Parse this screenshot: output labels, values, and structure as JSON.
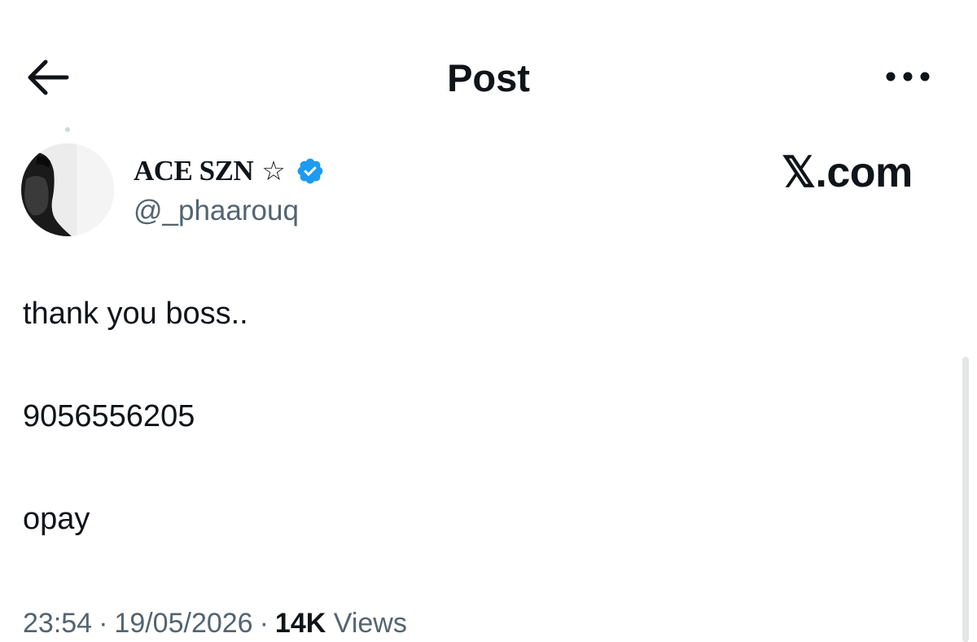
{
  "header": {
    "title": "Post",
    "back_icon": "arrow-left-icon",
    "more_icon": "more-horizontal-icon"
  },
  "author": {
    "display_name": "ACE SZN",
    "name_symbol": "☆",
    "handle": "@_phaarouq",
    "verified": true,
    "verified_color": "#1d9bf0"
  },
  "watermark": "𝕏.com",
  "post": {
    "lines": [
      "thank you boss..",
      "9056556205",
      "opay"
    ]
  },
  "meta": {
    "time": "23:54",
    "separator": "·",
    "date": "19/05/2026",
    "views_count": "14K",
    "views_label": "Views"
  },
  "colors": {
    "text": "#0f1419",
    "secondary_text": "#536471",
    "background": "#ffffff"
  }
}
